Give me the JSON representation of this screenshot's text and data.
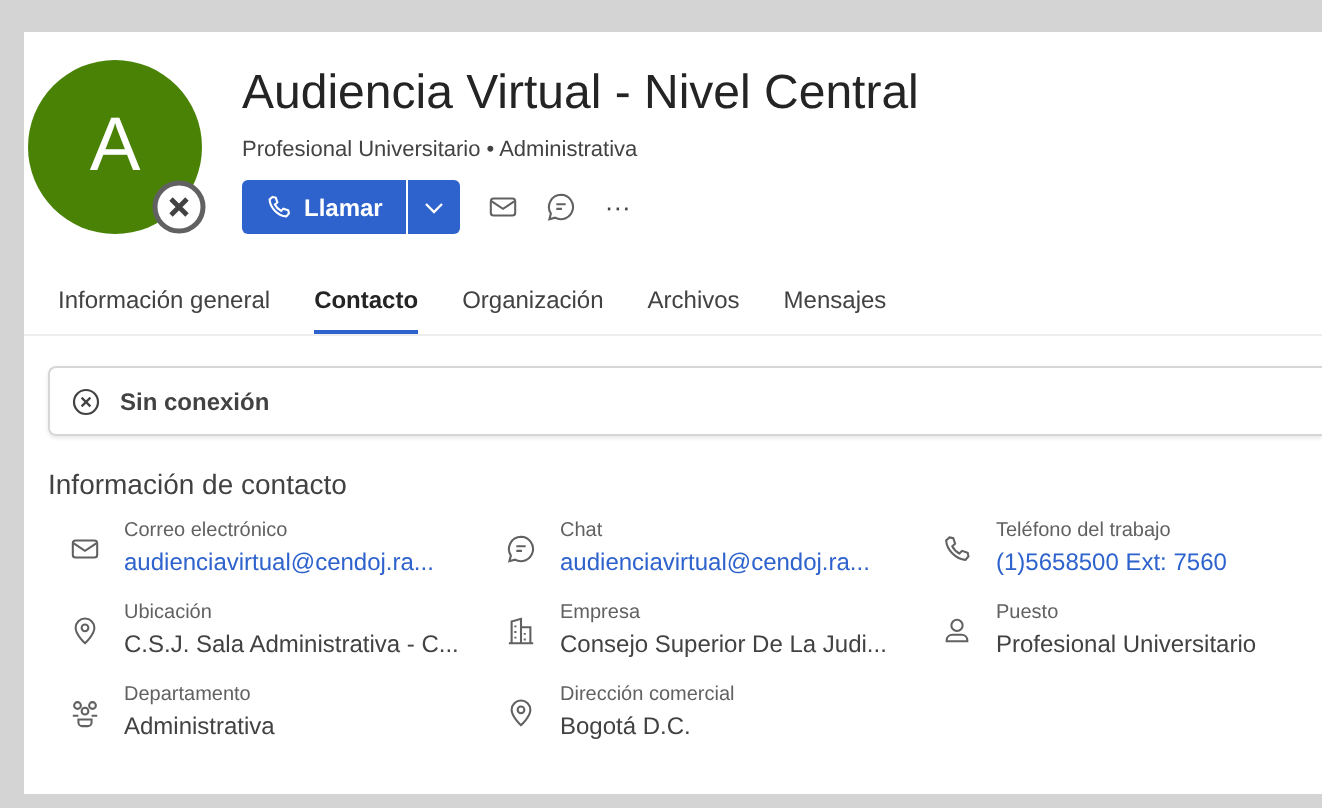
{
  "profile": {
    "initial": "A",
    "offline": true,
    "name": "Audiencia Virtual - Nivel Central",
    "subtitle": "Profesional Universitario • Administrativa"
  },
  "actions": {
    "call_label": "Llamar",
    "more": "···"
  },
  "tabs": [
    {
      "label": "Información general",
      "selected": false
    },
    {
      "label": "Contacto",
      "selected": true
    },
    {
      "label": "Organización",
      "selected": false
    },
    {
      "label": "Archivos",
      "selected": false
    },
    {
      "label": "Mensajes",
      "selected": false
    }
  ],
  "status_banner": {
    "text": "Sin conexión"
  },
  "contact_section": {
    "title": "Información de contacto",
    "fields": [
      {
        "kind": "mail",
        "label": "Correo electrónico",
        "value": "audienciavirtual@cendoj.ra...",
        "link": true
      },
      {
        "kind": "chat",
        "label": "Chat",
        "value": "audienciavirtual@cendoj.ra...",
        "link": true
      },
      {
        "kind": "phone",
        "label": "Teléfono del trabajo",
        "value": "(1)5658500 Ext: 7560",
        "link": true
      },
      {
        "kind": "location",
        "label": "Ubicación",
        "value": "C.S.J. Sala Administrativa - C...",
        "link": false
      },
      {
        "kind": "company",
        "label": "Empresa",
        "value": "Consejo Superior De La Judi...",
        "link": false
      },
      {
        "kind": "person",
        "label": "Puesto",
        "value": "Profesional Universitario",
        "link": false
      },
      {
        "kind": "group",
        "label": "Departamento",
        "value": "Administrativa",
        "link": false
      },
      {
        "kind": "location",
        "label": "Dirección comercial",
        "value": "Bogotá D.C.",
        "link": false
      }
    ]
  }
}
